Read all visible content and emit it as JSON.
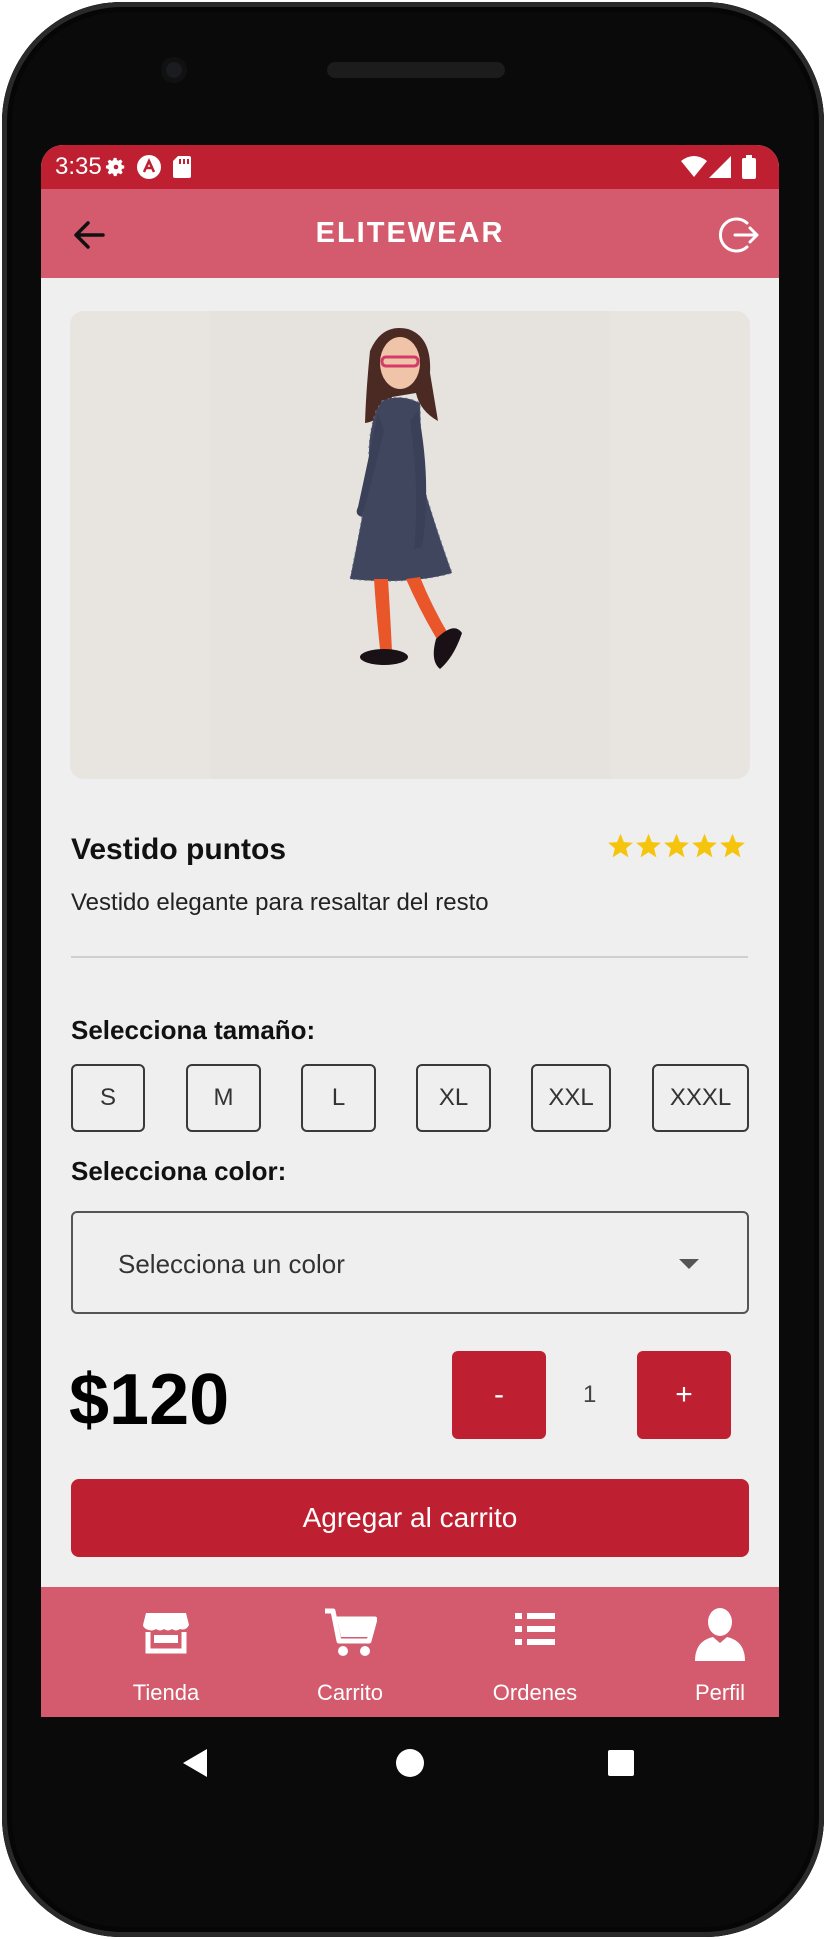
{
  "status": {
    "time": "3:35"
  },
  "app": {
    "title": "ELITEWEAR"
  },
  "product": {
    "name": "Vestido puntos",
    "rating": 5,
    "description": "Vestido elegante para resaltar del resto",
    "price": "$120"
  },
  "size": {
    "label": "Selecciona tamaño:",
    "options": [
      "S",
      "M",
      "L",
      "XL",
      "XXL",
      "XXXL"
    ]
  },
  "color": {
    "label": "Selecciona color:",
    "placeholder": "Selecciona un color"
  },
  "quantity": {
    "minus": "-",
    "value": "1",
    "plus": "+"
  },
  "cart_button": "Agregar al carrito",
  "nav": [
    {
      "label": "Tienda",
      "icon": "store-icon"
    },
    {
      "label": "Carrito",
      "icon": "cart-icon"
    },
    {
      "label": "Ordenes",
      "icon": "list-icon"
    },
    {
      "label": "Perfil",
      "icon": "person-icon"
    }
  ],
  "colors": {
    "primary": "#be2031",
    "appbar": "#d35b6d",
    "background": "#efefef"
  }
}
